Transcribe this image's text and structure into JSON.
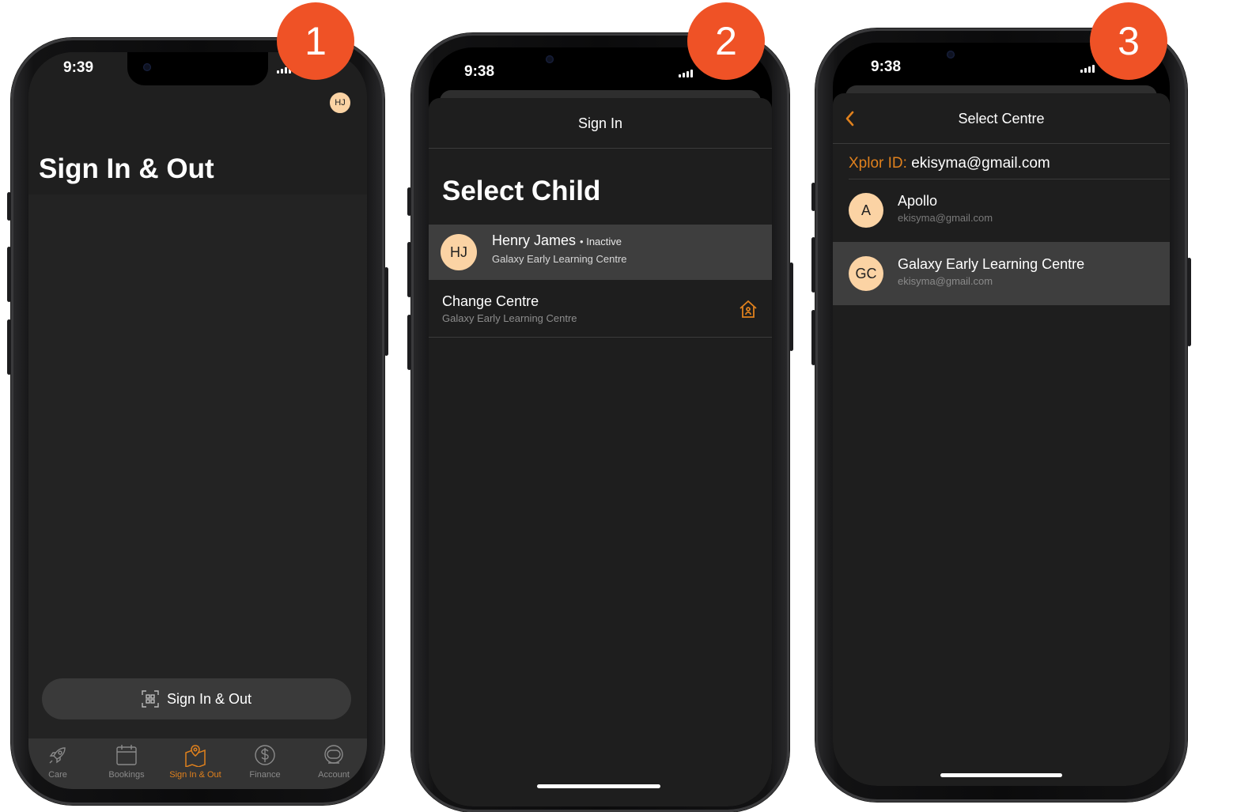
{
  "badges": [
    "1",
    "2",
    "3"
  ],
  "phone1": {
    "time": "9:39",
    "avatar": "HJ",
    "title": "Sign In & Out",
    "action_button": "Sign In & Out",
    "tabs": [
      {
        "label": "Care",
        "icon": "rocket-icon"
      },
      {
        "label": "Bookings",
        "icon": "calendar-icon"
      },
      {
        "label": "Sign In & Out",
        "icon": "map-pin-icon"
      },
      {
        "label": "Finance",
        "icon": "dollar-icon"
      },
      {
        "label": "Account",
        "icon": "astronaut-helmet-icon"
      }
    ],
    "active_tab_color": "#e0811d"
  },
  "phone2": {
    "time": "9:38",
    "nav_title": "Sign In",
    "title": "Select Child",
    "child": {
      "initials": "HJ",
      "name": "Henry James",
      "status": "• Inactive",
      "centre": "Galaxy Early Learning Centre"
    },
    "change_centre": {
      "label": "Change Centre",
      "sub": "Galaxy Early Learning Centre",
      "icon": "house-icon"
    }
  },
  "phone3": {
    "time": "9:38",
    "nav_title": "Select Centre",
    "xplor_label": "Xplor ID:",
    "xplor_value": "ekisyma@gmail.com",
    "centres": [
      {
        "initials": "A",
        "name": "Apollo",
        "email": "ekisyma@gmail.com"
      },
      {
        "initials": "GC",
        "name": "Galaxy Early Learning Centre",
        "email": "ekisyma@gmail.com"
      }
    ]
  },
  "colors": {
    "accent": "#e0811d",
    "badge": "#ef5226",
    "avatar": "#fbd3a4"
  }
}
